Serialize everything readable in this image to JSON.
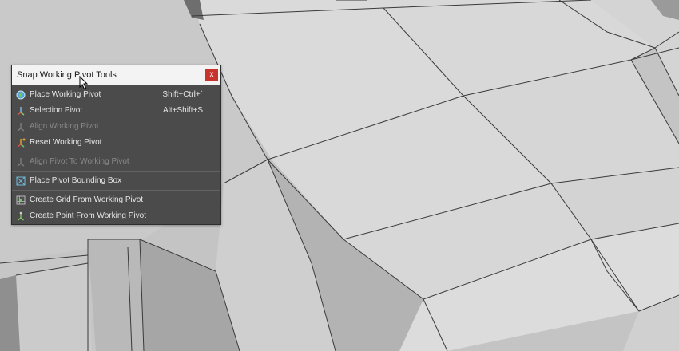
{
  "panel": {
    "title": "Snap Working Pivot Tools",
    "close_label": "x",
    "groups": [
      [
        {
          "label": "Place Working Pivot",
          "shortcut": "Shift+Ctrl+`",
          "icon": "place-pivot-icon",
          "enabled": true
        },
        {
          "label": "Selection Pivot",
          "shortcut": "Alt+Shift+S",
          "icon": "selection-pivot-icon",
          "enabled": true
        },
        {
          "label": "Align Working Pivot",
          "shortcut": "",
          "icon": "align-pivot-icon",
          "enabled": false
        },
        {
          "label": "Reset Working Pivot",
          "shortcut": "",
          "icon": "reset-pivot-icon",
          "enabled": true
        }
      ],
      [
        {
          "label": "Align Pivot To Working Pivot",
          "shortcut": "",
          "icon": "align-to-pivot-icon",
          "enabled": false
        }
      ],
      [
        {
          "label": "Place Pivot Bounding Box",
          "shortcut": "",
          "icon": "bounding-box-icon",
          "enabled": true
        }
      ],
      [
        {
          "label": "Create Grid From Working Pivot",
          "shortcut": "",
          "icon": "create-grid-icon",
          "enabled": true
        },
        {
          "label": "Create Point From Working Pivot",
          "shortcut": "",
          "icon": "create-point-icon",
          "enabled": true
        }
      ]
    ]
  },
  "colors": {
    "panel_bg": "#4b4b4b",
    "header_bg": "#f3f3f3",
    "close_bg": "#c8342c",
    "text": "#e6e6e6",
    "disabled_text": "#8a8a8a"
  }
}
